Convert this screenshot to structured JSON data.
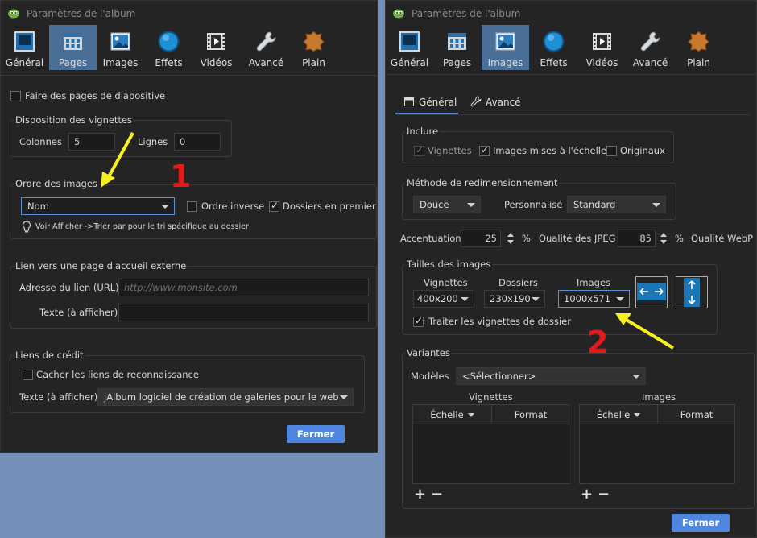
{
  "left": {
    "title": "Paramètres de l'album",
    "toolbar": [
      "Général",
      "Pages",
      "Images",
      "Effets",
      "Vidéos",
      "Avancé",
      "Plain"
    ],
    "active_tab": "Pages",
    "slide_pages": "Faire des pages de diapositive",
    "thumb_layout": {
      "legend": "Disposition des vignettes",
      "columns_label": "Colonnes",
      "columns_value": "5",
      "rows_label": "Lignes",
      "rows_value": "0"
    },
    "image_order": {
      "legend": "Ordre des images",
      "select_value": "Nom",
      "reverse": "Ordre inverse",
      "folders_first": "Dossiers en premier",
      "hint": "Voir Afficher ->Trier par pour le tri spécifique au dossier"
    },
    "external_link": {
      "legend": "Lien vers une page d'accueil externe",
      "url_label": "Adresse du lien (URL)",
      "url_placeholder": "http://www.monsite.com",
      "text_label": "Texte (à afficher)",
      "text_value": ""
    },
    "credits": {
      "legend": "Liens de crédit",
      "hide": "Cacher les liens de reconnaissance",
      "text_label": "Texte (à afficher)",
      "text_value": "jAlbum logiciel de création de galeries pour le web"
    },
    "close": "Fermer",
    "annotation": "1"
  },
  "right": {
    "title": "Paramètres de l'album",
    "toolbar": [
      "Général",
      "Pages",
      "Images",
      "Effets",
      "Vidéos",
      "Avancé",
      "Plain"
    ],
    "active_tab": "Images",
    "subtabs": [
      "Général",
      "Avancé"
    ],
    "include": {
      "legend": "Inclure",
      "thumbs": "Vignettes",
      "scaled": "Images mises à l'échelle",
      "originals": "Originaux"
    },
    "resize": {
      "legend": "Méthode de redimensionnement",
      "method": "Douce",
      "custom_label": "Personnalisé",
      "custom_value": "Standard"
    },
    "sharpen": {
      "label": "Accentuation",
      "value": "25",
      "unit": "%",
      "jpeg_label": "Qualité des JPEG",
      "jpeg_value": "85",
      "jpeg_unit": "%",
      "webp_label": "Qualité WebP"
    },
    "sizes": {
      "legend": "Tailles des images",
      "thumbs_label": "Vignettes",
      "thumbs_value": "400x200",
      "folders_label": "Dossiers",
      "folders_value": "230x190",
      "images_label": "Images",
      "images_value": "1000x571",
      "process_folders": "Traiter les vignettes de dossier"
    },
    "variants": {
      "legend": "Variantes",
      "models_label": "Modèles",
      "models_value": "<Sélectionner>",
      "thumbs_title": "Vignettes",
      "images_title": "Images",
      "col_scale": "Échelle",
      "col_format": "Format",
      "plus": "+",
      "minus": "−"
    },
    "close": "Fermer",
    "annotation": "2"
  },
  "colors": {
    "accent": "#4f86e0",
    "active_tab": "#4a6f97",
    "arrow": "#f5f01e",
    "annotation": "#e21a1a",
    "panel": "#242424",
    "background": "#7391b8"
  }
}
